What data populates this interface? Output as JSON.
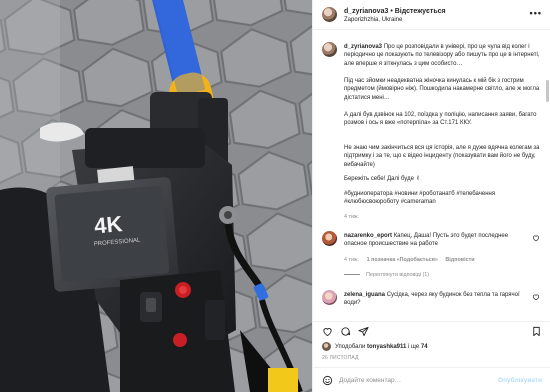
{
  "post": {
    "author": "d_zyrianova3",
    "separator": "•",
    "follow_label": "Відстежується",
    "location": "Zaporizhzhia, Ukraine"
  },
  "caption": {
    "author": "d_zyrianova3",
    "para1": "Про це розповідали в універі, про це чула від колег і періодично це показують по телевізору або пишуть про це в інтернеті, але вперше я зіткнулась з цим особисто…",
    "para2": "Під час зйомки неадекватна жіночка кинулась к мій бік з гострим предметом (ймовірно ніж). Пошкодила накамерне світло, але ж могла дістатися мені…",
    "para3": "А далі був дзвінок на 102, поїздка у поліцію, написання заяви, багато розмов і ось я вже «потерпіла» за Ст.171 ККУ.",
    "para4": "Не знаю чим закінчиться вся ця історія, але я дуже вдячна колегам за підтримку і за те, що є відео інциденту (показувати вам його не буду, вибачайте)",
    "para5": "Бережіть себе! Далі буде ✌",
    "hashtags": "#будниоператора #новини #роботанатб #телебачення #клюбюсвоюроботу #cameraman",
    "time": "4 тиж."
  },
  "comments": [
    {
      "author": "nazarenko_eport",
      "text": "Капец, Даша! Пусть это будет последнее опасное происшествие на работе",
      "time": "4 тиж.",
      "likes": "1 позначка «Подобається»",
      "reply": "Відповісти",
      "view_replies": "Переглянути відповіді (1)"
    },
    {
      "author": "zelena_iguana",
      "text": "Сусідка, через яку будинок без тепла та гарячої води?",
      "time": "",
      "likes": "",
      "reply": "",
      "view_replies": ""
    }
  ],
  "footer": {
    "liked_by_prefix": "Уподобали",
    "liked_by_user": "tonyashka911",
    "liked_by_suffix": "і ще",
    "liked_by_count": "74",
    "date": "26 ЛИСТОПАД",
    "comment_placeholder": "Додайте коментар…",
    "post_label": "Опублікувати"
  },
  "icons": {
    "more": "more-horizontal-icon",
    "like": "heart-icon",
    "comment": "comment-bubble-icon",
    "share": "paper-plane-icon",
    "save": "bookmark-icon",
    "emoji": "smiley-icon"
  },
  "colors": {
    "link_blue": "#0095f6",
    "hashtag_blue": "#00376b",
    "muted": "#8e8e8e",
    "post_disabled": "#b2dffc"
  }
}
